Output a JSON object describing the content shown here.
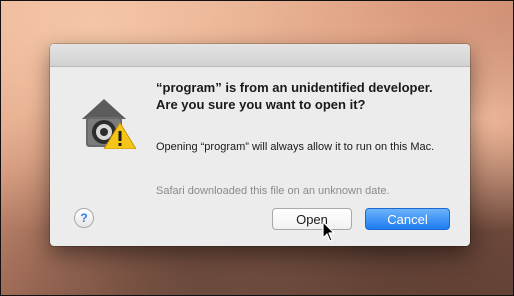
{
  "dialog": {
    "headline": "“program” is from an unidentified developer. Are you sure you want to open it?",
    "info": "Opening “program” will always allow it to run on this Mac.",
    "note": "Safari downloaded this file on an unknown date.",
    "help_label": "?",
    "open_label": "Open",
    "cancel_label": "Cancel"
  },
  "icons": {
    "app": "gatekeeper-warning-icon",
    "cursor": "mouse-cursor-icon"
  },
  "colors": {
    "accent": "#1d7cf2",
    "warning": "#f5c518"
  }
}
